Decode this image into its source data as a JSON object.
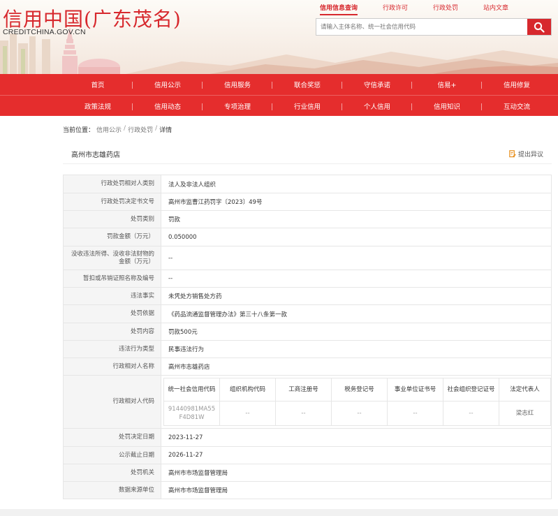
{
  "header": {
    "logo_main": "信用中国(广东茂名)",
    "logo_sub": "CREDITCHINA.GOV.CN",
    "top_nav": [
      "信用信息查询",
      "行政许可",
      "行政处罚",
      "站内文章"
    ],
    "search_placeholder": "请输入主体名称、统一社会信用代码",
    "search_icon": "search-icon",
    "accent": "#d7282d"
  },
  "main_nav": {
    "row1": [
      "首页",
      "信用公示",
      "信用服务",
      "联合奖惩",
      "守信承诺",
      "信易+",
      "信用修复"
    ],
    "row2": [
      "政策法规",
      "信用动态",
      "专项治理",
      "行业信用",
      "个人信用",
      "信用知识",
      "互动交流"
    ],
    "bg": "#e52d2d"
  },
  "breadcrumb": {
    "prefix": "当前位置：",
    "items": [
      "信用公示",
      "行政处罚",
      "详情"
    ],
    "sep": "/"
  },
  "page": {
    "title": "高州市志雄药店",
    "objection_label": "提出异议",
    "objection_icon": "edit-document-icon"
  },
  "detail": {
    "rows_top": [
      {
        "label": "行政处罚相对人类别",
        "value": "法人及非法人组织"
      },
      {
        "label": "行政处罚决定书文号",
        "value": "高州市监曹江药罚字〔2023〕49号"
      },
      {
        "label": "处罚类别",
        "value": "罚款"
      },
      {
        "label": "罚款金额（万元）",
        "value": "0.050000"
      },
      {
        "label": "没收违法所得、没收非法财物的金额（万元）",
        "value": "--"
      },
      {
        "label": "暂扣或吊销证照名称及编号",
        "value": "--"
      },
      {
        "label": "违法事实",
        "value": "未凭处方销售处方药"
      },
      {
        "label": "处罚依据",
        "value": "《药品流通监督管理办法》第三十八条第一款"
      },
      {
        "label": "处罚内容",
        "value": "罚款500元"
      },
      {
        "label": "违法行为类型",
        "value": "民事违法行为"
      },
      {
        "label": "行政相对人名称",
        "value": "高州市志雄药店"
      }
    ],
    "code_label": "行政相对人代码",
    "code_headers": [
      "统一社会信用代码",
      "组织机构代码",
      "工商注册号",
      "税务登记号",
      "事业单位证书号",
      "社会组织登记证号",
      "法定代表人"
    ],
    "code_values": [
      "91440981MA55F4D81W",
      "--",
      "--",
      "--",
      "--",
      "--",
      "梁志红"
    ],
    "rows_bottom": [
      {
        "label": "处罚决定日期",
        "value": "2023-11-27"
      },
      {
        "label": "公示截止日期",
        "value": "2026-11-27"
      },
      {
        "label": "处罚机关",
        "value": "高州市市场监督管理局"
      },
      {
        "label": "数据来源单位",
        "value": "高州市市场监督管理局"
      }
    ]
  }
}
